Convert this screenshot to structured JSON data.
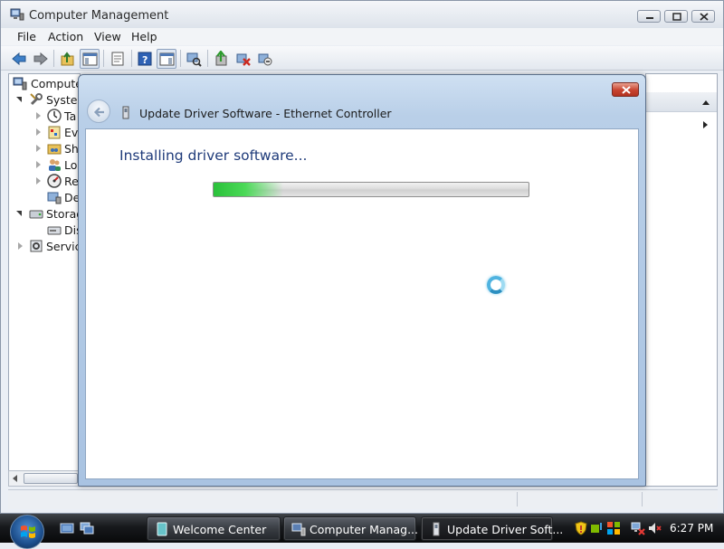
{
  "window": {
    "title": "Computer Management",
    "menu": [
      "File",
      "Action",
      "View",
      "Help"
    ]
  },
  "tree": {
    "items": [
      {
        "label": "Computer",
        "level": 0,
        "expanded": true
      },
      {
        "label": "System",
        "level": 1,
        "expanded": true
      },
      {
        "label": "Ta",
        "level": 2
      },
      {
        "label": "Eve",
        "level": 2
      },
      {
        "label": "Sh",
        "level": 2
      },
      {
        "label": "Lo",
        "level": 2
      },
      {
        "label": "Re",
        "level": 2
      },
      {
        "label": "De",
        "level": 2,
        "selected": true
      },
      {
        "label": "Storag",
        "level": 1,
        "expanded": true
      },
      {
        "label": "Dis",
        "level": 2
      },
      {
        "label": "Service",
        "level": 1
      }
    ]
  },
  "dialog": {
    "title": "Update Driver Software - Ethernet Controller",
    "heading": "Installing driver software...",
    "progress_fraction": 0.22
  },
  "taskbar": {
    "buttons": [
      {
        "label": "Welcome Center"
      },
      {
        "label": "Computer Manag..."
      },
      {
        "label": "Update Driver Soft..."
      }
    ],
    "clock": "6:27 PM"
  },
  "colors": {
    "dialog_heading": "#1f3b7a",
    "progress_green": "#2ac13a",
    "close_red": "#c8432f"
  },
  "icons": [
    "back-arrow-icon",
    "forward-arrow-icon",
    "up-folder-icon",
    "show-hide-tree-icon",
    "properties-icon",
    "help-icon",
    "action-pane-icon",
    "scan-hardware-icon",
    "update-driver-icon",
    "disable-device-icon",
    "uninstall-device-icon",
    "windows-logo-icon",
    "network-adapter-icon",
    "spinner-icon"
  ]
}
